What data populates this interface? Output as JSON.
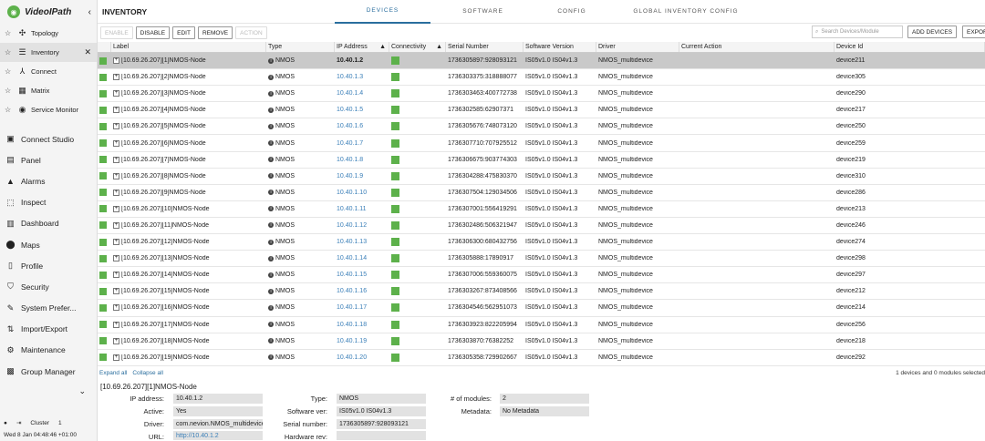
{
  "sidebar": {
    "logo_text": "VideoIPath",
    "pinned": [
      {
        "label": "Topology",
        "icon": "topology-icon"
      },
      {
        "label": "Inventory",
        "icon": "list-icon"
      },
      {
        "label": "Connect",
        "icon": "connect-icon"
      },
      {
        "label": "Matrix",
        "icon": "grid-icon"
      },
      {
        "label": "Service Monitor",
        "icon": "eye-icon"
      }
    ],
    "menu": [
      {
        "label": "Connect Studio",
        "icon": "monitor-icon"
      },
      {
        "label": "Panel",
        "icon": "panel-icon"
      },
      {
        "label": "Alarms",
        "icon": "alarm-icon"
      },
      {
        "label": "Inspect",
        "icon": "inspect-icon"
      },
      {
        "label": "Dashboard",
        "icon": "dashboard-icon"
      },
      {
        "label": "Maps",
        "icon": "map-pin-icon"
      },
      {
        "label": "Profile",
        "icon": "profile-icon"
      },
      {
        "label": "Security",
        "icon": "shield-icon"
      },
      {
        "label": "System Prefer...",
        "icon": "wrench-icon"
      },
      {
        "label": "Import/Export",
        "icon": "import-export-icon"
      },
      {
        "label": "Maintenance",
        "icon": "maintenance-icon"
      },
      {
        "label": "Group Manager",
        "icon": "group-icon"
      }
    ],
    "cluster_label": "Cluster",
    "cluster_value": "1",
    "datetime": "Wed 8 Jan   04:48:46 +01:00"
  },
  "header": {
    "title": "INVENTORY",
    "tabs": [
      "DEVICES",
      "SOFTWARE",
      "CONFIG",
      "GLOBAL INVENTORY CONFIG"
    ],
    "active_tab": 0
  },
  "toolbar": {
    "enable": "ENABLE",
    "disable": "DISABLE",
    "edit": "EDIT",
    "remove": "REMOVE",
    "action": "ACTION",
    "search_placeholder": "Search Devices/Module",
    "add_devices": "ADD DEVICES",
    "export": "EXPORT"
  },
  "table": {
    "columns": [
      "Label",
      "Type",
      "IP Address",
      "Connectivity",
      "Serial Number",
      "Software Version",
      "Driver",
      "Current Action",
      "Device Id"
    ],
    "rows": [
      {
        "label": "[10.69.26.207][1]NMOS-Node",
        "type": "NMOS",
        "ip": "10.40.1.2",
        "serial": "1736305897:928093121",
        "sw": "IS05v1.0 IS04v1.3",
        "driver": "NMOS_multidevice",
        "action": "",
        "id": "device211"
      },
      {
        "label": "[10.69.26.207][2]NMOS-Node",
        "type": "NMOS",
        "ip": "10.40.1.3",
        "serial": "1736303375:318888077",
        "sw": "IS05v1.0 IS04v1.3",
        "driver": "NMOS_multidevice",
        "action": "",
        "id": "device305"
      },
      {
        "label": "[10.69.26.207][3]NMOS-Node",
        "type": "NMOS",
        "ip": "10.40.1.4",
        "serial": "1736303463:400772738",
        "sw": "IS05v1.0 IS04v1.3",
        "driver": "NMOS_multidevice",
        "action": "",
        "id": "device290"
      },
      {
        "label": "[10.69.26.207][4]NMOS-Node",
        "type": "NMOS",
        "ip": "10.40.1.5",
        "serial": "1736302585:62907371",
        "sw": "IS05v1.0 IS04v1.3",
        "driver": "NMOS_multidevice",
        "action": "",
        "id": "device217"
      },
      {
        "label": "[10.69.26.207][5]NMOS-Node",
        "type": "NMOS",
        "ip": "10.40.1.6",
        "serial": "1736305676:748073120",
        "sw": "IS05v1.0 IS04v1.3",
        "driver": "NMOS_multidevice",
        "action": "",
        "id": "device250"
      },
      {
        "label": "[10.69.26.207][6]NMOS-Node",
        "type": "NMOS",
        "ip": "10.40.1.7",
        "serial": "1736307710:707925512",
        "sw": "IS05v1.0 IS04v1.3",
        "driver": "NMOS_multidevice",
        "action": "",
        "id": "device259"
      },
      {
        "label": "[10.69.26.207][7]NMOS-Node",
        "type": "NMOS",
        "ip": "10.40.1.8",
        "serial": "1736306675:903774303",
        "sw": "IS05v1.0 IS04v1.3",
        "driver": "NMOS_multidevice",
        "action": "",
        "id": "device219"
      },
      {
        "label": "[10.69.26.207][8]NMOS-Node",
        "type": "NMOS",
        "ip": "10.40.1.9",
        "serial": "1736304288:475830370",
        "sw": "IS05v1.0 IS04v1.3",
        "driver": "NMOS_multidevice",
        "action": "",
        "id": "device310"
      },
      {
        "label": "[10.69.26.207][9]NMOS-Node",
        "type": "NMOS",
        "ip": "10.40.1.10",
        "serial": "1736307504:129034506",
        "sw": "IS05v1.0 IS04v1.3",
        "driver": "NMOS_multidevice",
        "action": "",
        "id": "device286"
      },
      {
        "label": "[10.69.26.207][10]NMOS-Node",
        "type": "NMOS",
        "ip": "10.40.1.11",
        "serial": "1736307001:556419291",
        "sw": "IS05v1.0 IS04v1.3",
        "driver": "NMOS_multidevice",
        "action": "",
        "id": "device213"
      },
      {
        "label": "[10.69.26.207][11]NMOS-Node",
        "type": "NMOS",
        "ip": "10.40.1.12",
        "serial": "1736302486:506321947",
        "sw": "IS05v1.0 IS04v1.3",
        "driver": "NMOS_multidevice",
        "action": "",
        "id": "device246"
      },
      {
        "label": "[10.69.26.207][12]NMOS-Node",
        "type": "NMOS",
        "ip": "10.40.1.13",
        "serial": "1736306300:680432756",
        "sw": "IS05v1.0 IS04v1.3",
        "driver": "NMOS_multidevice",
        "action": "",
        "id": "device274"
      },
      {
        "label": "[10.69.26.207][13]NMOS-Node",
        "type": "NMOS",
        "ip": "10.40.1.14",
        "serial": "1736305888:17890917",
        "sw": "IS05v1.0 IS04v1.3",
        "driver": "NMOS_multidevice",
        "action": "",
        "id": "device298"
      },
      {
        "label": "[10.69.26.207][14]NMOS-Node",
        "type": "NMOS",
        "ip": "10.40.1.15",
        "serial": "1736307006:559360075",
        "sw": "IS05v1.0 IS04v1.3",
        "driver": "NMOS_multidevice",
        "action": "",
        "id": "device297"
      },
      {
        "label": "[10.69.26.207][15]NMOS-Node",
        "type": "NMOS",
        "ip": "10.40.1.16",
        "serial": "1736303267:873408566",
        "sw": "IS05v1.0 IS04v1.3",
        "driver": "NMOS_multidevice",
        "action": "",
        "id": "device212"
      },
      {
        "label": "[10.69.26.207][16]NMOS-Node",
        "type": "NMOS",
        "ip": "10.40.1.17",
        "serial": "1736304546:562951073",
        "sw": "IS05v1.0 IS04v1.3",
        "driver": "NMOS_multidevice",
        "action": "",
        "id": "device214"
      },
      {
        "label": "[10.69.26.207][17]NMOS-Node",
        "type": "NMOS",
        "ip": "10.40.1.18",
        "serial": "1736303923:822205994",
        "sw": "IS05v1.0 IS04v1.3",
        "driver": "NMOS_multidevice",
        "action": "",
        "id": "device256"
      },
      {
        "label": "[10.69.26.207][18]NMOS-Node",
        "type": "NMOS",
        "ip": "10.40.1.19",
        "serial": "1736303870:76382252",
        "sw": "IS05v1.0 IS04v1.3",
        "driver": "NMOS_multidevice",
        "action": "",
        "id": "device218"
      },
      {
        "label": "[10.69.26.207][19]NMOS-Node",
        "type": "NMOS",
        "ip": "10.40.1.20",
        "serial": "1736305358:729902667",
        "sw": "IS05v1.0 IS04v1.3",
        "driver": "NMOS_multidevice",
        "action": "",
        "id": "device292"
      }
    ],
    "expand_all": "Expand all",
    "collapse_all": "Collapse all",
    "selection_count": "1 devices and 0 modules selected"
  },
  "detail": {
    "title": "[10.69.26.207][1]NMOS-Node",
    "ip_address_label": "IP address:",
    "ip_address": "10.40.1.2",
    "active_label": "Active:",
    "active": "Yes",
    "driver_label": "Driver:",
    "driver": "com.nevion.NMOS_multidevice",
    "url_label": "URL:",
    "url": "http://10.40.1.2",
    "type_label": "Type:",
    "type": "NMOS",
    "software_label": "Software ver:",
    "software": "IS05v1.0 IS04v1.3",
    "serial_label": "Serial number:",
    "serial": "1736305897:928093121",
    "hardware_label": "Hardware rev:",
    "hardware": "",
    "modules_label": "# of modules:",
    "modules": "2",
    "metadata_label": "Metadata:",
    "metadata": "No Metadata"
  },
  "colors": {
    "accent": "#2a6e9e",
    "connectivity_ok": "#5db14b",
    "selected_row": "#c9c9c9"
  }
}
